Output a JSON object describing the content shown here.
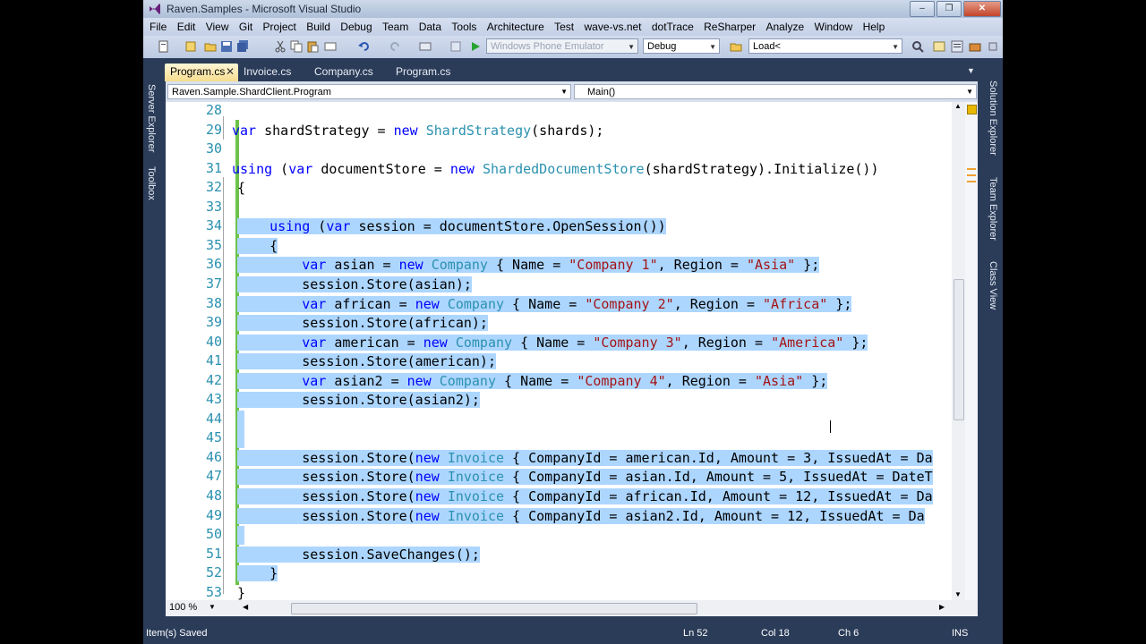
{
  "window": {
    "title": "Raven.Samples - Microsoft Visual Studio"
  },
  "menu": [
    "File",
    "Edit",
    "View",
    "Git",
    "Project",
    "Build",
    "Debug",
    "Team",
    "Data",
    "Tools",
    "Architecture",
    "Test",
    "wave-vs.net",
    "dotTrace",
    "ReSharper",
    "Analyze",
    "Window",
    "Help"
  ],
  "toolbar": {
    "device": "Windows Phone Emulator",
    "config": "Debug",
    "find": "Load<"
  },
  "tabs": [
    {
      "label": "Program.cs",
      "active": true
    },
    {
      "label": "Invoice.cs"
    },
    {
      "label": "Company.cs"
    },
    {
      "label": "Program.cs"
    }
  ],
  "navbar": {
    "type": "Raven.Sample.ShardClient.Program",
    "member": "Main()"
  },
  "side_left": [
    "Server Explorer",
    "Toolbox"
  ],
  "side_right": [
    "Solution Explorer",
    "Team Explorer",
    "Class View"
  ],
  "code": [
    {
      "n": "28",
      "t": ""
    },
    {
      "n": "29",
      "t": "var shardStrategy = new ShardStrategy(shards);"
    },
    {
      "n": "30",
      "t": ""
    },
    {
      "n": "31",
      "t": "using (var documentStore = new ShardedDocumentStore(shardStrategy).Initialize())"
    },
    {
      "n": "32",
      "t": "{"
    },
    {
      "n": "33",
      "t": ""
    },
    {
      "n": "34",
      "t": "    using (var session = documentStore.OpenSession())"
    },
    {
      "n": "35",
      "t": "    {"
    },
    {
      "n": "36",
      "t": "        var asian = new Company { Name = \"Company 1\", Region = \"Asia\" };"
    },
    {
      "n": "37",
      "t": "        session.Store(asian);"
    },
    {
      "n": "38",
      "t": "        var african = new Company { Name = \"Company 2\", Region = \"Africa\" };"
    },
    {
      "n": "39",
      "t": "        session.Store(african);"
    },
    {
      "n": "40",
      "t": "        var american = new Company { Name = \"Company 3\", Region = \"America\" };"
    },
    {
      "n": "41",
      "t": "        session.Store(american);"
    },
    {
      "n": "42",
      "t": "        var asian2 = new Company { Name = \"Company 4\", Region = \"Asia\" };"
    },
    {
      "n": "43",
      "t": "        session.Store(asian2);"
    },
    {
      "n": "44",
      "t": ""
    },
    {
      "n": "45",
      "t": ""
    },
    {
      "n": "46",
      "t": "        session.Store(new Invoice { CompanyId = american.Id, Amount = 3, IssuedAt = Da"
    },
    {
      "n": "47",
      "t": "        session.Store(new Invoice { CompanyId = asian.Id, Amount = 5, IssuedAt = DateT"
    },
    {
      "n": "48",
      "t": "        session.Store(new Invoice { CompanyId = african.Id, Amount = 12, IssuedAt = Da"
    },
    {
      "n": "49",
      "t": "        session.Store(new Invoice { CompanyId = asian2.Id, Amount = 12, IssuedAt = Da"
    },
    {
      "n": "50",
      "t": ""
    },
    {
      "n": "51",
      "t": "        session.SaveChanges();"
    },
    {
      "n": "52",
      "t": "    }"
    },
    {
      "n": "53",
      "t": "}"
    }
  ],
  "zoom": "100 %",
  "status": {
    "message": "Item(s) Saved",
    "ln": "Ln 52",
    "col": "Col 18",
    "ch": "Ch 6",
    "mode": "INS"
  }
}
